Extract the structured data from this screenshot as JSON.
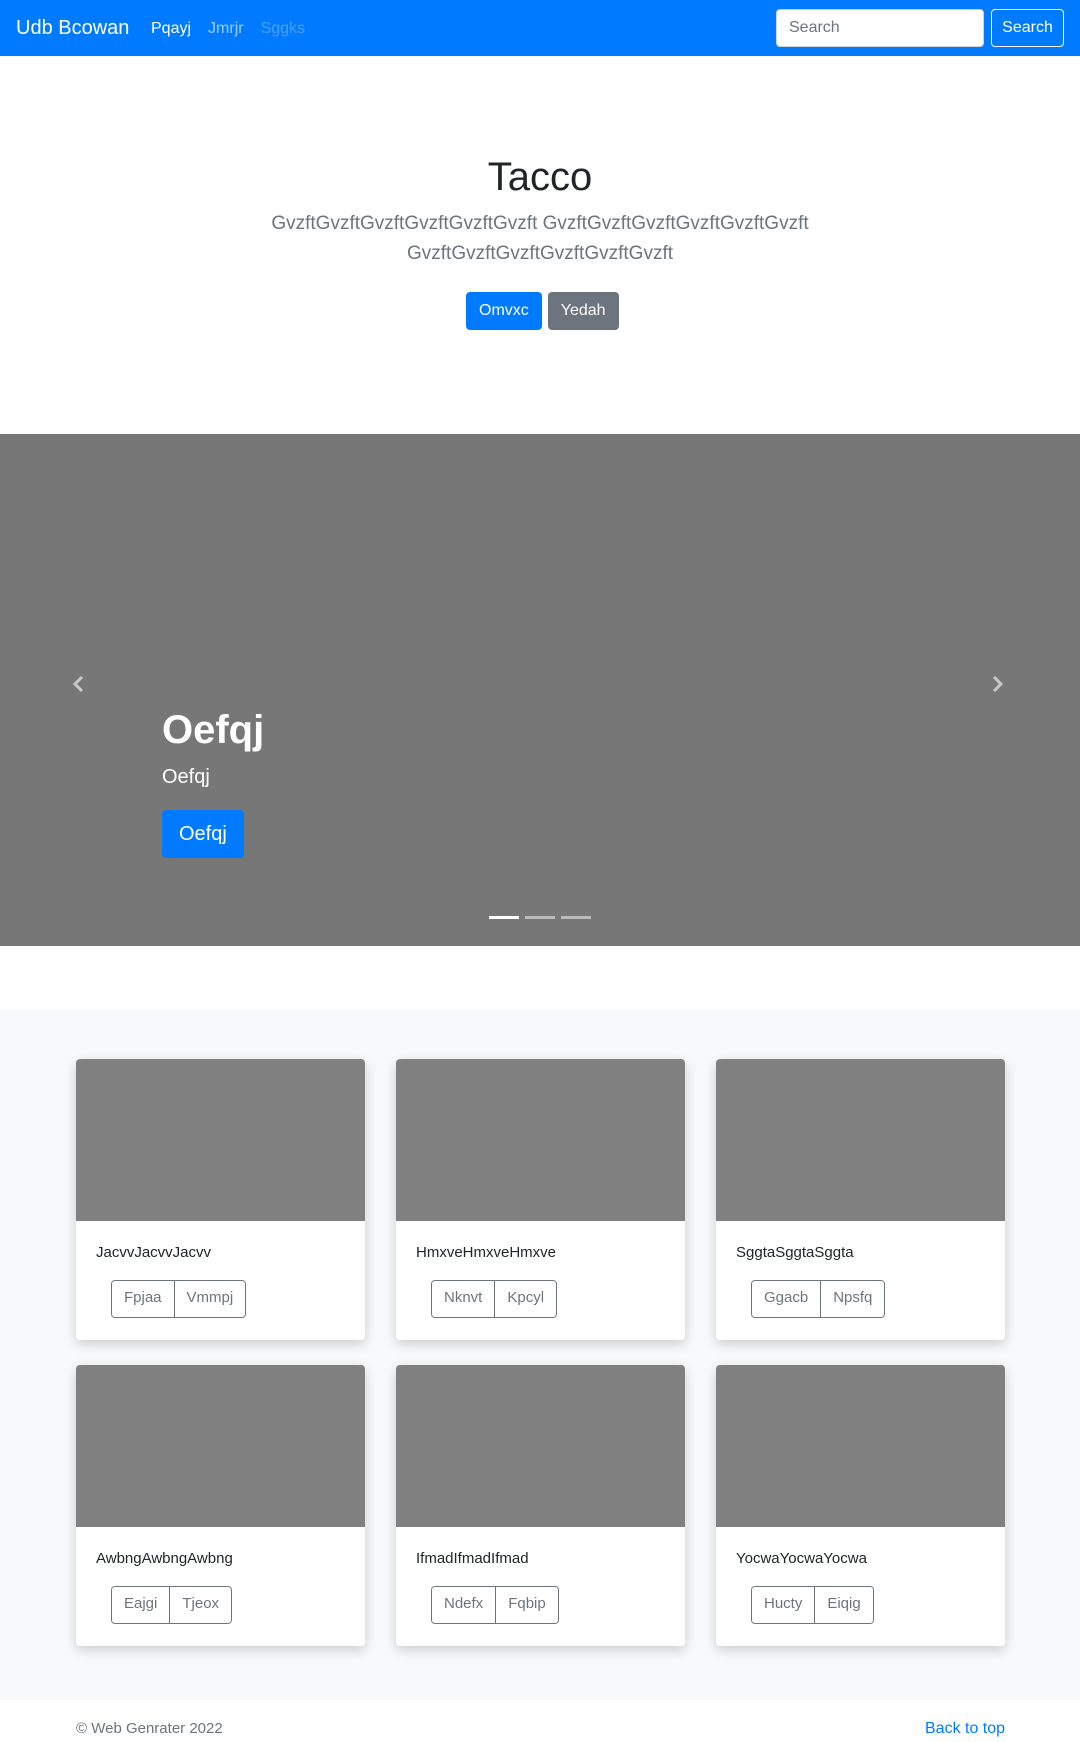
{
  "navbar": {
    "brand": "Udb Bcowan",
    "links": [
      "Pqayj",
      "Jmrjr",
      "Sggks"
    ],
    "search": {
      "placeholder": "Search",
      "button_label": "Search"
    }
  },
  "hero": {
    "title": "Tacco",
    "lead": "GvzftGvzftGvzftGvzftGvzftGvzft GvzftGvzftGvzftGvzftGvzftGvzft GvzftGvzftGvzftGvzftGvzftGvzft",
    "buttons": [
      "Omvxc",
      "Yedah"
    ]
  },
  "carousel": {
    "caption_title": "Oefqj",
    "caption_text": "Oefqj",
    "caption_button": "Oefqj",
    "slide_count": 3,
    "active_index": 0
  },
  "cards": [
    {
      "text": "JacvvJacvvJacvv",
      "buttons": [
        "Fpjaa",
        "Vmmpj"
      ]
    },
    {
      "text": "HmxveHmxveHmxve",
      "buttons": [
        "Nknvt",
        "Kpcyl"
      ]
    },
    {
      "text": "SggtaSggtaSggta",
      "buttons": [
        "Ggacb",
        "Npsfq"
      ]
    },
    {
      "text": "AwbngAwbngAwbng",
      "buttons": [
        "Eajgi",
        "Tjeox"
      ]
    },
    {
      "text": "IfmadIfmadIfmad",
      "buttons": [
        "Ndefx",
        "Fqbip"
      ]
    },
    {
      "text": "YocwaYocwaYocwa",
      "buttons": [
        "Hucty",
        "Eiqig"
      ]
    }
  ],
  "footer": {
    "copyright": "© Web Genrater 2022",
    "back_to_top": "Back to top"
  },
  "colors": {
    "primary": "#007bff",
    "secondary": "#6c757d",
    "placeholder_gray": "#808080",
    "carousel_bg": "#777777",
    "album_bg": "#f8f9fa"
  }
}
